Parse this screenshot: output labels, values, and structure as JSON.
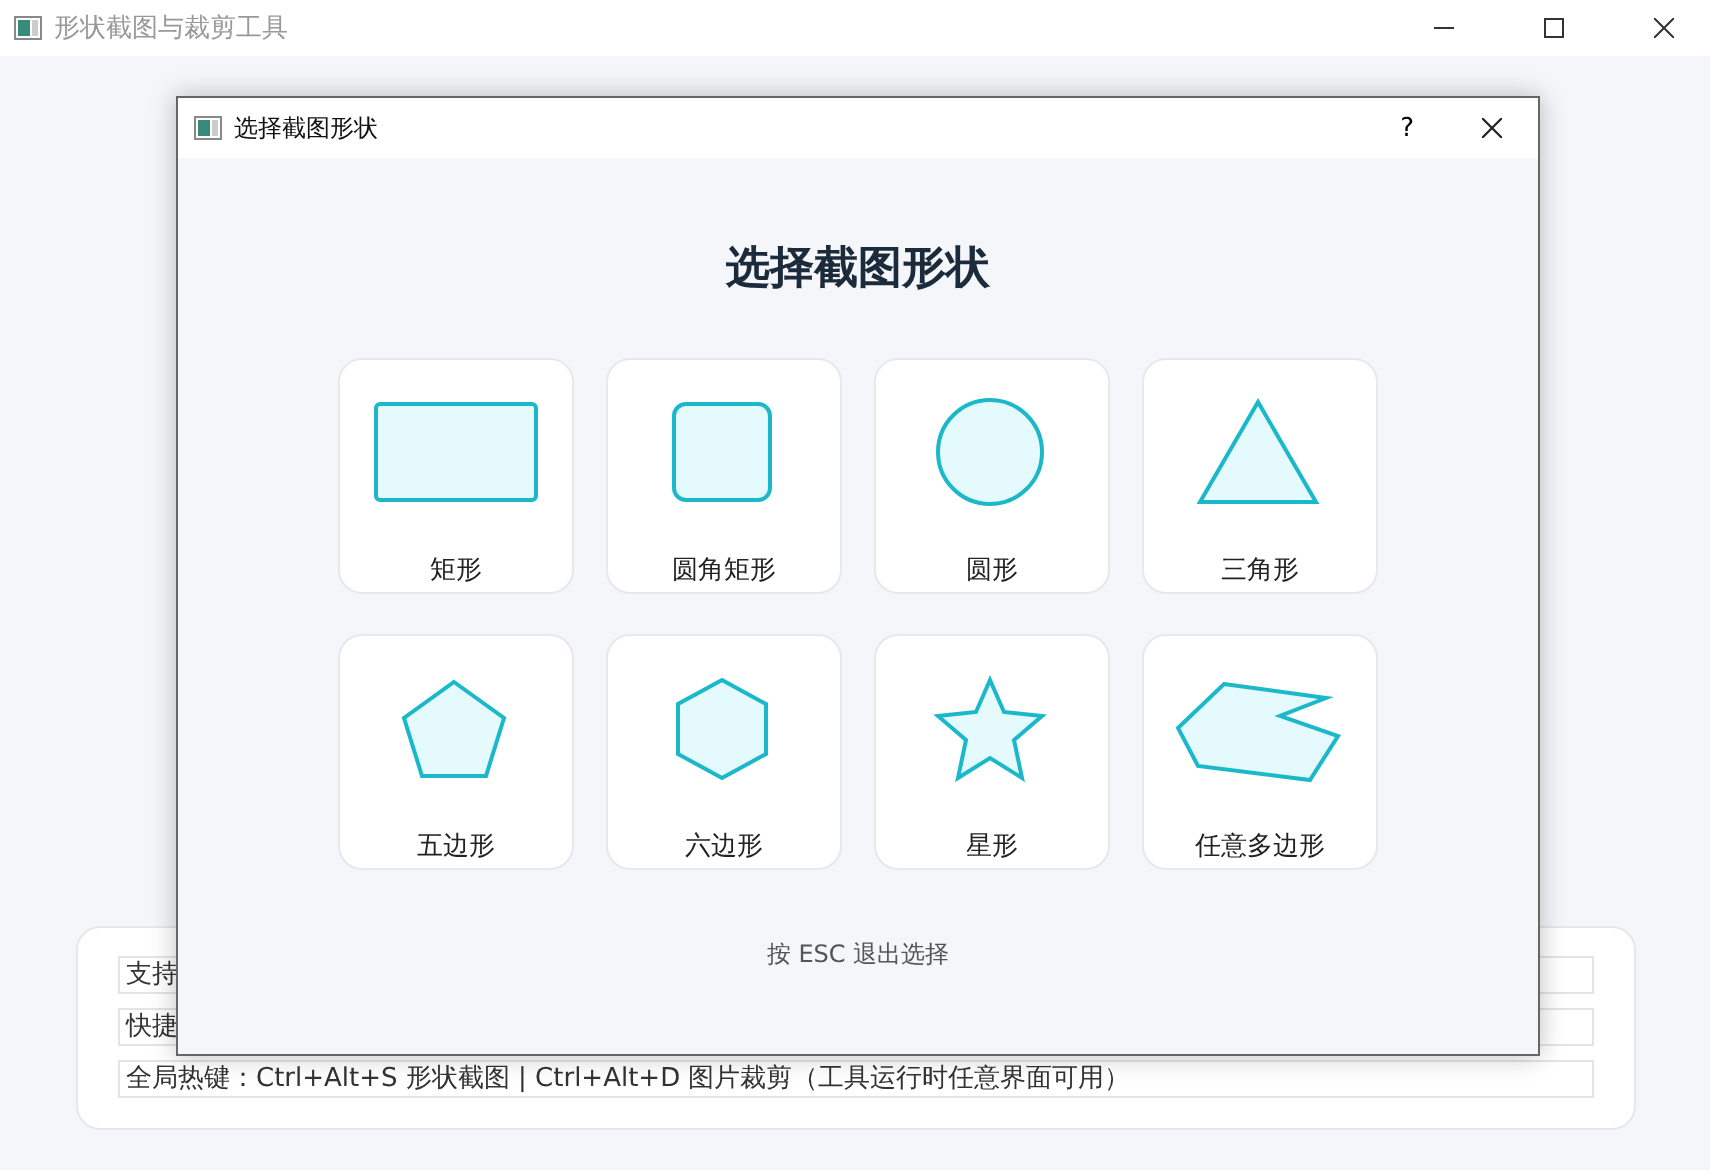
{
  "window": {
    "title": "形状截图与裁剪工具"
  },
  "info_lines": [
    "支持",
    "快捷",
    "全局热键：Ctrl+Alt+S 形状截图 | Ctrl+Alt+D 图片裁剪（工具运行时任意界面可用）"
  ],
  "dialog": {
    "title": "选择截图形状",
    "help": "?",
    "heading": "选择截图形状",
    "shapes": [
      {
        "kind": "rect",
        "label": "矩形"
      },
      {
        "kind": "roundrect",
        "label": "圆角矩形"
      },
      {
        "kind": "circle",
        "label": "圆形"
      },
      {
        "kind": "triangle",
        "label": "三角形"
      },
      {
        "kind": "pentagon",
        "label": "五边形"
      },
      {
        "kind": "hexagon",
        "label": "六边形"
      },
      {
        "kind": "star",
        "label": "星形"
      },
      {
        "kind": "polygon",
        "label": "任意多边形"
      }
    ],
    "hint": "按 ESC 退出选择"
  }
}
